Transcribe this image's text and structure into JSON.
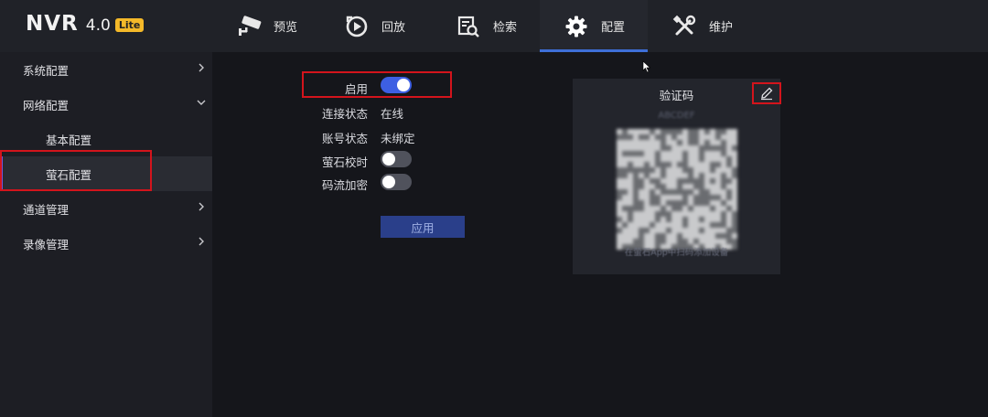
{
  "brand": {
    "name": "NVR",
    "version": "4.0",
    "edition": "Lite",
    "edition_color": "#f4b929"
  },
  "nav": {
    "tabs": [
      {
        "label": "预览",
        "icon": "camera-icon"
      },
      {
        "label": "回放",
        "icon": "playback-icon"
      },
      {
        "label": "检索",
        "icon": "search-document-icon"
      },
      {
        "label": "配置",
        "icon": "gear-icon"
      },
      {
        "label": "维护",
        "icon": "tools-icon"
      }
    ],
    "active_tab": "配置",
    "accent": "#3e6fd8"
  },
  "sidebar": {
    "items": [
      {
        "label": "系统配置",
        "icon": "chevron-right-icon"
      },
      {
        "label": "网络配置",
        "icon": "chevron-down-icon"
      },
      {
        "label": "基本配置"
      },
      {
        "label": "萤石配置"
      },
      {
        "label": "通道管理",
        "icon": "chevron-right-icon"
      },
      {
        "label": "录像管理",
        "icon": "chevron-right-icon"
      }
    ],
    "selected": "萤石配置"
  },
  "form": {
    "enable_label": "启用",
    "enable_on": true,
    "conn_status_label": "连接状态",
    "conn_status_value": "在线",
    "account_status_label": "账号状态",
    "account_status_value": "未绑定",
    "time_sync_label": "萤石校时",
    "time_sync_on": false,
    "stream_encrypt_label": "码流加密",
    "stream_encrypt_on": false,
    "apply_label": "应用",
    "toggle_on_color": "#3d5fe3"
  },
  "qr": {
    "title": "验证码",
    "code": "ABCDEF",
    "caption": "在萤石App中扫码添加设备",
    "edit_icon": "pencil-icon"
  },
  "highlight_color": "#d3141c"
}
